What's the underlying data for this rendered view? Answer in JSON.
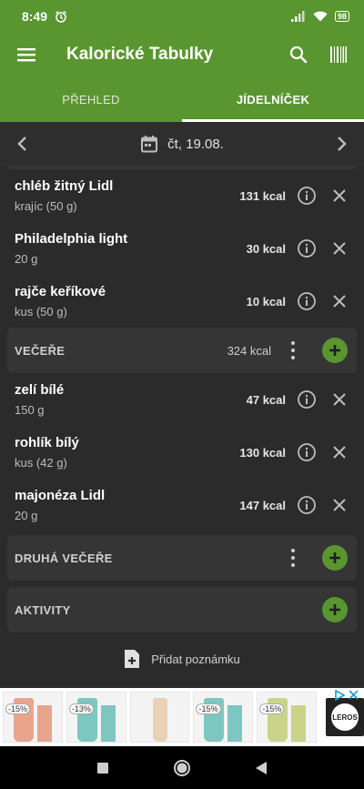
{
  "status_bar": {
    "time": "8:49",
    "battery": "98"
  },
  "app_bar": {
    "title": "Kalorické Tabulky"
  },
  "tabs": [
    {
      "label": "PŘEHLED",
      "active": false
    },
    {
      "label": "JÍDELNÍČEK",
      "active": true
    }
  ],
  "date_nav": {
    "date": "čt, 19.08."
  },
  "food_items_1": [
    {
      "name": "chléb žitný Lidl",
      "portion": "krajíc (50 g)",
      "kcal": "131 kcal"
    },
    {
      "name": "Philadelphia light",
      "portion": "20 g",
      "kcal": "30 kcal"
    },
    {
      "name": "rajče keříkové",
      "portion": "kus (50 g)",
      "kcal": "10 kcal"
    }
  ],
  "dinner": {
    "title": "VEČEŘE",
    "kcal": "324 kcal"
  },
  "food_items_2": [
    {
      "name": "zelí bílé",
      "portion": "150 g",
      "kcal": "47 kcal"
    },
    {
      "name": "rohlík bílý",
      "portion": "kus (42 g)",
      "kcal": "130 kcal"
    },
    {
      "name": "majonéza Lidl",
      "portion": "20 g",
      "kcal": "147 kcal"
    }
  ],
  "second_dinner": {
    "title": "DRUHÁ VEČEŘE"
  },
  "activities": {
    "title": "AKTIVITY"
  },
  "add_note": {
    "label": "Přidat poznámku"
  },
  "ad": {
    "cards": [
      {
        "discount": "-15%",
        "color": "#e8a58c"
      },
      {
        "discount": "-13%",
        "color": "#7ec7c0"
      },
      {
        "discount": "",
        "color": "#e9d2b6"
      },
      {
        "discount": "-15%",
        "color": "#7ec7c0"
      },
      {
        "discount": "-15%",
        "color": "#c9d48a"
      }
    ],
    "brand": "LEROS"
  },
  "colors": {
    "accent": "#5a9630",
    "background": "#2b2b2b"
  }
}
